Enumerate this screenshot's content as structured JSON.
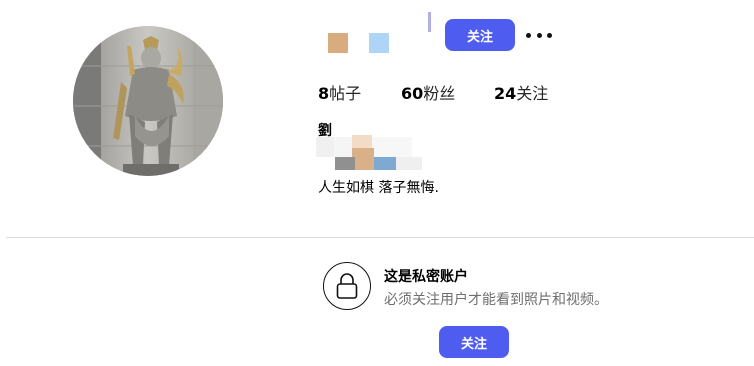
{
  "profile": {
    "follow_label": "关注",
    "display_name": "劉",
    "bio": "人生如棋 落子無悔."
  },
  "stats": [
    {
      "count": "8",
      "label": "帖子"
    },
    {
      "count": "60",
      "label": "粉丝"
    },
    {
      "count": "24",
      "label": "关注"
    }
  ],
  "private_notice": {
    "title": "这是私密账户",
    "subtitle": "必须关注用户才能看到照片和视频。",
    "follow_label": "关注"
  },
  "colors": {
    "accent": "#4f5cf0",
    "divider": "#dbdbdb",
    "secondary_text": "#6e6e6e"
  },
  "icons": {
    "lock": "lock-icon",
    "more": "more-options-icon"
  }
}
